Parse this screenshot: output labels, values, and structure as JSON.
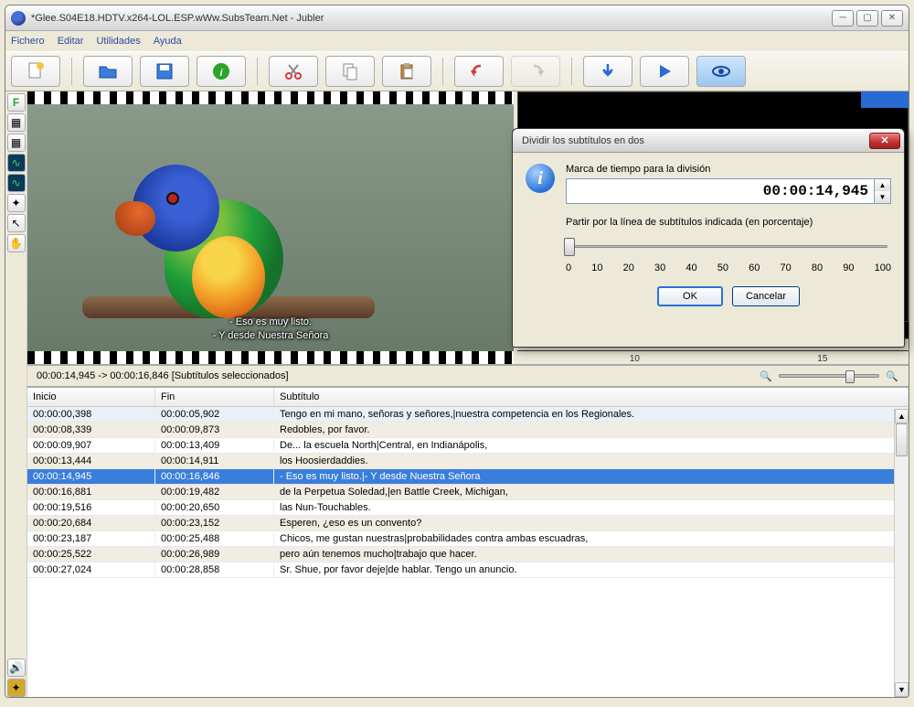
{
  "window": {
    "title": "*Glee.S04E18.HDTV.x264-LOL.ESP.wWw.SubsTeam.Net - Jubler"
  },
  "menu": {
    "file": "Fichero",
    "edit": "Editar",
    "utilities": "Utilidades",
    "help": "Ayuda"
  },
  "preview": {
    "subtitle_line1": "- Eso es muy listo.",
    "subtitle_line2": "- Y desde Nuestra Señora"
  },
  "timeline": {
    "tick1": "10",
    "tick2": "15"
  },
  "dialog": {
    "title": "Dividir los subtítulos en dos",
    "label_time": "Marca de tiempo para la división",
    "time_value": "00:00:14,945",
    "label_percent": "Partir por la línea de subtítulos indicada (en porcentaje)",
    "ticks": [
      "0",
      "10",
      "20",
      "30",
      "40",
      "50",
      "60",
      "70",
      "80",
      "90",
      "100"
    ],
    "ok": "OK",
    "cancel": "Cancelar"
  },
  "status": {
    "text": "00:00:14,945 -> 00:00:16,846 [Subtítulos seleccionados]"
  },
  "table": {
    "col_start": "Inicio",
    "col_end": "Fin",
    "col_text": "Subtítulo",
    "rows": [
      {
        "start": "00:00:00,398",
        "end": "00:00:05,902",
        "text": "Tengo en mi mano, señoras y señores,|nuestra competencia en los Regionales."
      },
      {
        "start": "00:00:08,339",
        "end": "00:00:09,873",
        "text": "Redobles, por favor."
      },
      {
        "start": "00:00:09,907",
        "end": "00:00:13,409",
        "text": "De... la escuela North|Central, en Indianápolis,"
      },
      {
        "start": "00:00:13,444",
        "end": "00:00:14,911",
        "text": "los Hoosierdaddies."
      },
      {
        "start": "00:00:14,945",
        "end": "00:00:16,846",
        "text": "- Eso es muy listo.|- Y desde Nuestra Señora"
      },
      {
        "start": "00:00:16,881",
        "end": "00:00:19,482",
        "text": "de la Perpetua Soledad,|en Battle Creek, Michigan,"
      },
      {
        "start": "00:00:19,516",
        "end": "00:00:20,650",
        "text": "las Nun-Touchables."
      },
      {
        "start": "00:00:20,684",
        "end": "00:00:23,152",
        "text": "Esperen, ¿eso es un convento?"
      },
      {
        "start": "00:00:23,187",
        "end": "00:00:25,488",
        "text": "Chicos, me gustan nuestras|probabilidades contra ambas escuadras,"
      },
      {
        "start": "00:00:25,522",
        "end": "00:00:26,989",
        "text": "pero aún tenemos mucho|trabajo que hacer."
      },
      {
        "start": "00:00:27,024",
        "end": "00:00:28,858",
        "text": "Sr. Shue, por favor deje|de hablar. Tengo un anuncio."
      }
    ],
    "selected_index": 4
  }
}
